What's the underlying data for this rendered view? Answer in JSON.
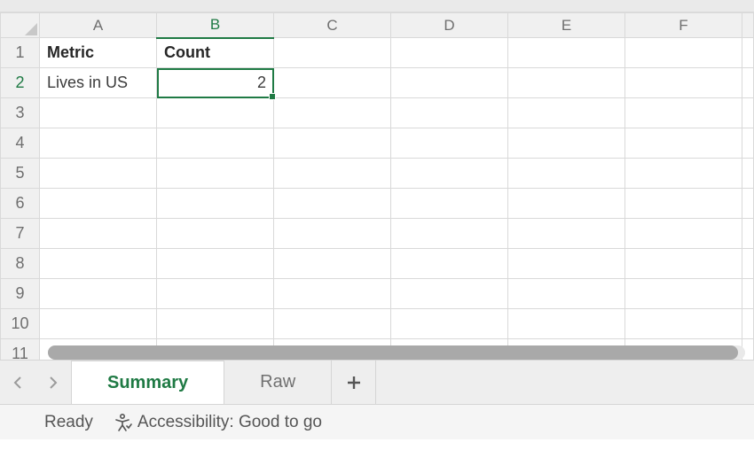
{
  "columns": [
    "A",
    "B",
    "C",
    "D",
    "E",
    "F"
  ],
  "rows": [
    "1",
    "2",
    "3",
    "4",
    "5",
    "6",
    "7",
    "8",
    "9",
    "10",
    "11"
  ],
  "active_column_index": 1,
  "active_row_index": 1,
  "cells": {
    "A1": "Metric",
    "B1": "Count",
    "A2": "Lives in US",
    "B2": "2"
  },
  "selected_cell": "B2",
  "tabs": {
    "items": [
      "Summary",
      "Raw"
    ],
    "active_index": 0
  },
  "status": {
    "ready": "Ready",
    "accessibility": "Accessibility: Good to go"
  }
}
